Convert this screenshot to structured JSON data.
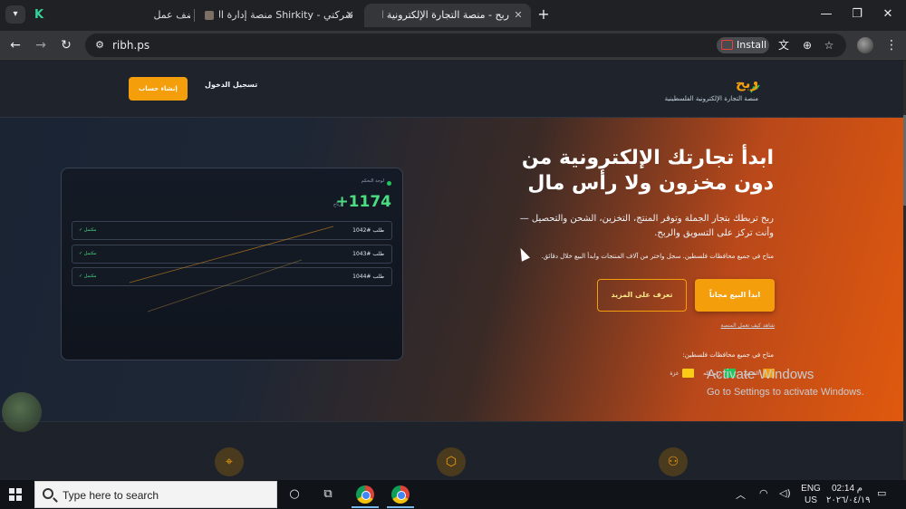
{
  "browser": {
    "tabs": [
      {
        "title": "أضف عمل",
        "active": false
      },
      {
        "title": "شركتي - Shirkity منصة إدارة الشر",
        "active": false
      },
      {
        "title": "ربح - منصة التجارة الإلكترونية الذكية",
        "active": true
      }
    ],
    "url": "ribh.ps",
    "install_label": "Install",
    "window_controls": [
      "minimize",
      "maximize",
      "close"
    ]
  },
  "site": {
    "brand_name": "ربح",
    "brand_tagline": "منصة التجارة الإلكترونية الفلسطينية",
    "nav_login": "تسجيل الدخول",
    "nav_signup": "إنشاء حساب",
    "hero": {
      "title": "ابدأ تجارتك الإلكترونية من دون مخزون ولا رأس مال",
      "description": "ربح تربطك بتجار الجملة وتوفر المنتج، التخزين، الشحن والتحصيل — وأنت تركز على التسويق والربح.",
      "note": "متاح في جميع محافظات فلسطين. سجل واختر من آلاف المنتجات وابدأ البيع خلال دقائق.",
      "cta_primary": "ابدأ البيع مجاناً",
      "cta_secondary": "تعرف على المزيد",
      "demo_link": "شاهد كيف تعمل المنصة",
      "areas_title": "متاح في جميع محافظات فلسطين:",
      "areas": [
        {
          "label": "القدس",
          "color": "#f59e0b"
        },
        {
          "label": "رام الله",
          "color": "#22c55e"
        },
        {
          "label": "غزة",
          "color": "#facc15"
        }
      ]
    },
    "dashboard": {
      "label": "لوحة التحكم",
      "value": "+1174",
      "unit": "أرباح",
      "orders": [
        {
          "name": "طلب #1042",
          "status": "✓ مكتمل"
        },
        {
          "name": "طلب #1043",
          "status": "✓ مكتمل"
        },
        {
          "name": "طلب #1044",
          "status": "✓ مكتمل"
        }
      ]
    },
    "features": [
      {
        "icon": "map-pin-icon"
      },
      {
        "icon": "box-icon"
      },
      {
        "icon": "users-icon"
      }
    ]
  },
  "os": {
    "activate_title": "Activate Windows",
    "activate_sub": "Go to Settings to activate Windows.",
    "search_placeholder": "Type here to search",
    "lang_top": "ENG",
    "lang_bottom": "US",
    "time": "02:14 م",
    "date": "٢٠٢٦/٠٤/١٩"
  }
}
